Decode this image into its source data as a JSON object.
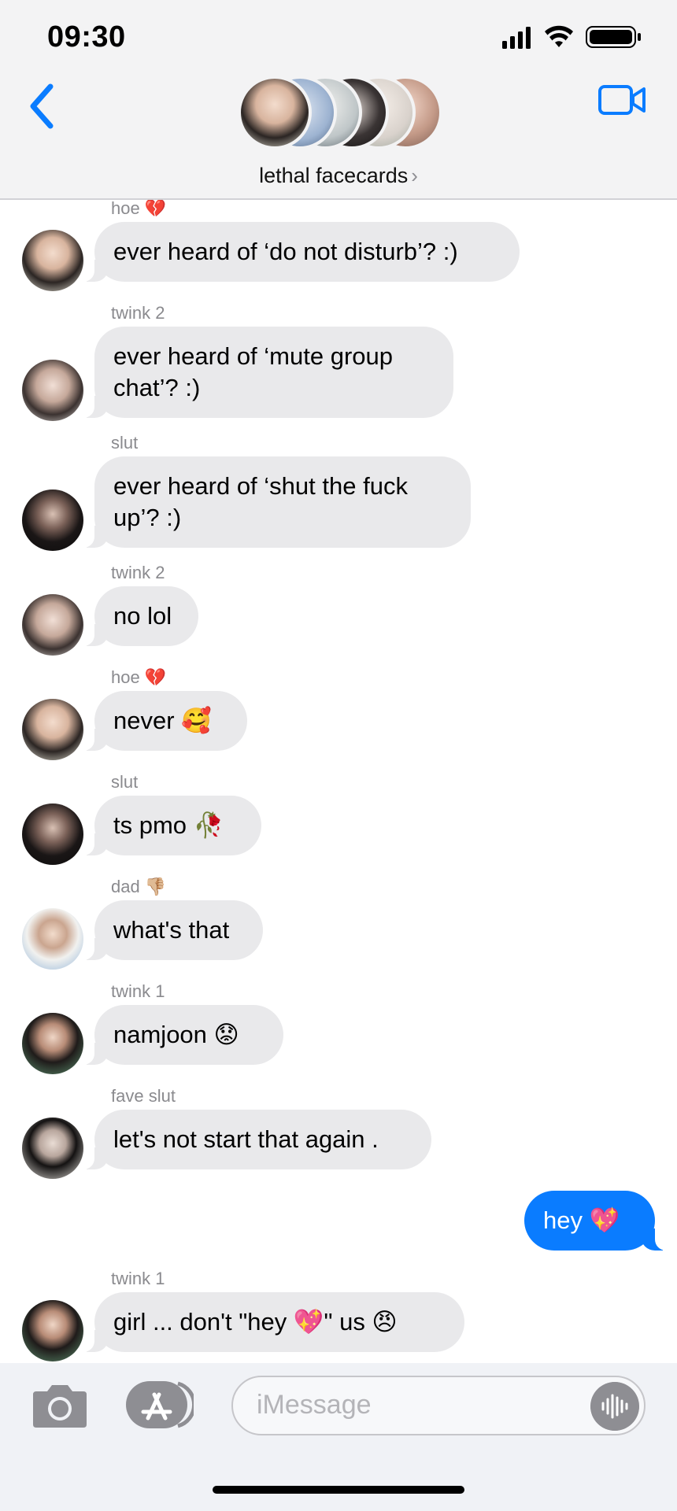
{
  "status_bar": {
    "time": "09:30"
  },
  "header": {
    "title": "lethal facecards",
    "chevron": "›",
    "back_icon": "chevron-left-icon",
    "video_icon": "video-camera-icon"
  },
  "messages": [
    {
      "sender": "hoe 💔",
      "text": "ever heard of ‘do not disturb’? :)",
      "outgoing": false
    },
    {
      "sender": "twink 2",
      "text": "ever heard of ‘mute group chat’? :)",
      "outgoing": false
    },
    {
      "sender": "slut",
      "text": "ever heard of ‘shut the fuck up’? :)",
      "outgoing": false
    },
    {
      "sender": "twink 2",
      "text": "no lol",
      "outgoing": false
    },
    {
      "sender": "hoe 💔",
      "text": "never 🥰",
      "outgoing": false
    },
    {
      "sender": "slut",
      "text": "ts pmo 🥀",
      "outgoing": false
    },
    {
      "sender": "dad 👎🏼",
      "text": "what's that",
      "outgoing": false
    },
    {
      "sender": "twink 1",
      "text": "namjoon 😟",
      "outgoing": false
    },
    {
      "sender": "fave slut",
      "text": "let's not start that again .",
      "outgoing": false
    },
    {
      "sender": "",
      "text": "hey 💖",
      "outgoing": true
    },
    {
      "sender": "twink 1",
      "text": "girl ... don't \"hey 💖\" us 😠",
      "outgoing": false
    }
  ],
  "input": {
    "placeholder": "iMessage",
    "camera_icon": "camera-icon",
    "apps_icon": "app-store-icon",
    "audio_icon": "audio-waveform-icon"
  },
  "colors": {
    "accent": "#0a7cff",
    "incoming_bubble": "#e9e9eb",
    "sender_label": "#8a8a8e"
  }
}
